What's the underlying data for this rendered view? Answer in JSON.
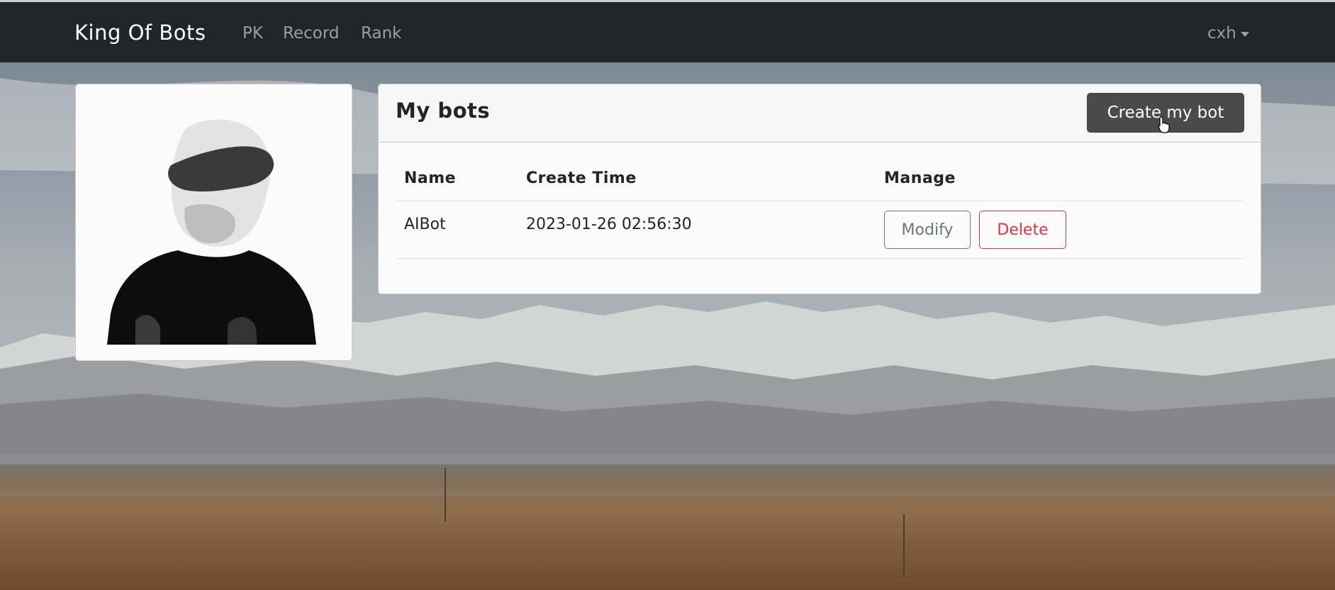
{
  "navbar": {
    "brand": "King Of Bots",
    "links": [
      "PK",
      "Record",
      "Rank"
    ],
    "user": "cxh"
  },
  "bots_card": {
    "title": "My bots",
    "create_button": "Create my bot",
    "table": {
      "headers": [
        "Name",
        "Create Time",
        "Manage"
      ],
      "rows": [
        {
          "name": "AIBot",
          "create_time": "2023-01-26 02:56:30"
        }
      ],
      "row_actions": [
        "Modify",
        "Delete"
      ]
    }
  },
  "colors": {
    "navbar_bg": "#212529",
    "create_button_bg": "#4a4a4a",
    "modify": "#6c757d",
    "delete": "#dc3545"
  },
  "icons": [
    "avatar-image",
    "caret-down-icon",
    "hand-pointer-cursor-icon"
  ]
}
